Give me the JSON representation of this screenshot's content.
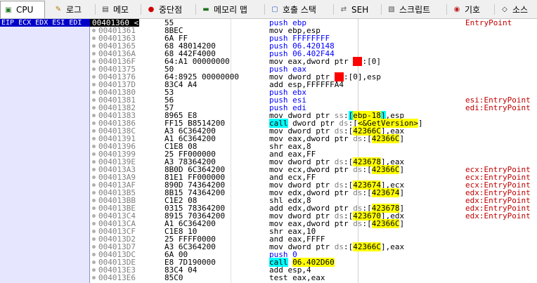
{
  "tabs": [
    {
      "label": "CPU",
      "icon": "cpu-icon",
      "active": true
    },
    {
      "label": "로그",
      "icon": "log-icon"
    },
    {
      "label": "메모",
      "icon": "notes-icon"
    },
    {
      "label": "중단점",
      "icon": "breakpoint-icon"
    },
    {
      "label": "메모리 맵",
      "icon": "memory-map-icon"
    },
    {
      "label": "호출 스택",
      "icon": "call-stack-icon"
    },
    {
      "label": "SEH",
      "icon": "seh-icon"
    },
    {
      "label": "스크립트",
      "icon": "script-icon"
    },
    {
      "label": "기호",
      "icon": "symbols-icon"
    },
    {
      "label": "소스",
      "icon": "source-icon"
    }
  ],
  "register_label": "EIP ECX EDX ESI EDI",
  "current_marker": "<",
  "colors": {
    "accent": "#0000c8",
    "comment": "#c00000",
    "highlight": "#ffff00",
    "call": "#00ffff"
  },
  "rows": [
    {
      "addr": "00401360",
      "bytes": "55",
      "instr": "push ebp",
      "comment": "EntryPoint",
      "type": "push",
      "current": true
    },
    {
      "addr": "00401361",
      "bytes": "8BEC",
      "instr": "mov ebp,esp",
      "comment": ""
    },
    {
      "addr": "00401363",
      "bytes": "6A FF",
      "instr": "push FFFFFFFF",
      "comment": "",
      "type": "push"
    },
    {
      "addr": "00401365",
      "bytes": "68 48014200",
      "instr": "push 06.420148",
      "comment": "",
      "type": "push"
    },
    {
      "addr": "0040136A",
      "bytes": "68 442F4000",
      "instr": "push 06.402F44",
      "comment": "",
      "type": "push"
    },
    {
      "addr": "0040136F",
      "bytes": "64:A1 00000000",
      "instr": "mov eax,dword ptr fs:[0]",
      "comment": ""
    },
    {
      "addr": "00401375",
      "bytes": "50",
      "instr": "push eax",
      "comment": "",
      "type": "push"
    },
    {
      "addr": "00401376",
      "bytes": "64:8925 00000000",
      "instr": "mov dword ptr fs:[0],esp",
      "comment": ""
    },
    {
      "addr": "0040137D",
      "bytes": "83C4 A4",
      "instr": "add esp,FFFFFFA4",
      "comment": ""
    },
    {
      "addr": "00401380",
      "bytes": "53",
      "instr": "push ebx",
      "comment": "",
      "type": "push"
    },
    {
      "addr": "00401381",
      "bytes": "56",
      "instr": "push esi",
      "comment": "esi:EntryPoint",
      "type": "push"
    },
    {
      "addr": "00401382",
      "bytes": "57",
      "instr": "push edi",
      "comment": "edi:EntryPoint",
      "type": "push"
    },
    {
      "addr": "00401383",
      "bytes": "8965 E8",
      "instr": "mov dword ptr ss:[ebp-18],esp",
      "comment": ""
    },
    {
      "addr": "00401386",
      "bytes": "FF15 B8514200",
      "instr": "call dword ptr ds:[<&GetVersion>]",
      "comment": "",
      "type": "call"
    },
    {
      "addr": "0040138C",
      "bytes": "A3 6C364200",
      "instr": "mov dword ptr ds:[42366C],eax",
      "comment": ""
    },
    {
      "addr": "00401391",
      "bytes": "A1 6C364200",
      "instr": "mov eax,dword ptr ds:[42366C]",
      "comment": ""
    },
    {
      "addr": "00401396",
      "bytes": "C1E8 08",
      "instr": "shr eax,8",
      "comment": ""
    },
    {
      "addr": "00401399",
      "bytes": "25 FF000000",
      "instr": "and eax,FF",
      "comment": ""
    },
    {
      "addr": "0040139E",
      "bytes": "A3 78364200",
      "instr": "mov dword ptr ds:[423678],eax",
      "comment": ""
    },
    {
      "addr": "004013A3",
      "bytes": "8B0D 6C364200",
      "instr": "mov ecx,dword ptr ds:[42366C]",
      "comment": "ecx:EntryPoint"
    },
    {
      "addr": "004013A9",
      "bytes": "81E1 FF000000",
      "instr": "and ecx,FF",
      "comment": "ecx:EntryPoint"
    },
    {
      "addr": "004013AF",
      "bytes": "890D 74364200",
      "instr": "mov dword ptr ds:[423674],ecx",
      "comment": "ecx:EntryPoint"
    },
    {
      "addr": "004013B5",
      "bytes": "8B15 74364200",
      "instr": "mov edx,dword ptr ds:[423674]",
      "comment": "edx:EntryPoint"
    },
    {
      "addr": "004013BB",
      "bytes": "C1E2 08",
      "instr": "shl edx,8",
      "comment": "edx:EntryPoint"
    },
    {
      "addr": "004013BE",
      "bytes": "0315 78364200",
      "instr": "add edx,dword ptr ds:[423678]",
      "comment": "edx:EntryPoint"
    },
    {
      "addr": "004013C4",
      "bytes": "8915 70364200",
      "instr": "mov dword ptr ds:[423670],edx",
      "comment": "edx:EntryPoint"
    },
    {
      "addr": "004013CA",
      "bytes": "A1 6C364200",
      "instr": "mov eax,dword ptr ds:[42366C]",
      "comment": ""
    },
    {
      "addr": "004013CF",
      "bytes": "C1E8 10",
      "instr": "shr eax,10",
      "comment": ""
    },
    {
      "addr": "004013D2",
      "bytes": "25 FFFF0000",
      "instr": "and eax,FFFF",
      "comment": ""
    },
    {
      "addr": "004013D7",
      "bytes": "A3 6C364200",
      "instr": "mov dword ptr ds:[42366C],eax",
      "comment": ""
    },
    {
      "addr": "004013DC",
      "bytes": "6A 00",
      "instr": "push 0",
      "comment": "",
      "type": "push"
    },
    {
      "addr": "004013DE",
      "bytes": "E8 7D190000",
      "instr": "call 06.402D60",
      "comment": "",
      "type": "call"
    },
    {
      "addr": "004013E3",
      "bytes": "83C4 04",
      "instr": "add esp,4",
      "comment": ""
    },
    {
      "addr": "004013E6",
      "bytes": "85C0",
      "instr": "test eax,eax",
      "comment": ""
    }
  ]
}
